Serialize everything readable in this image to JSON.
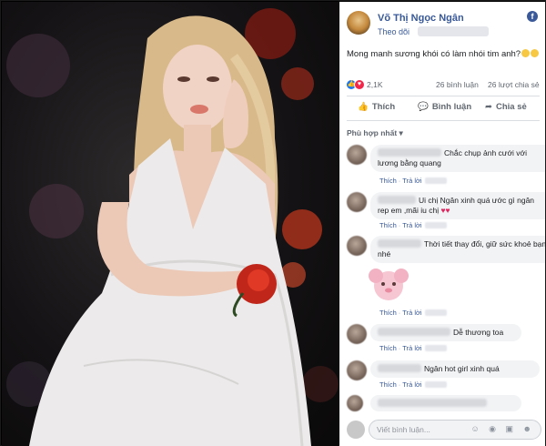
{
  "post": {
    "page_name": "Võ Thị Ngọc Ngân",
    "follow_label": "Theo dõi",
    "fb_icon": "f",
    "caption": "Mong manh sương khói có làm nhói tim anh?"
  },
  "reactions": {
    "like_icon": "👍",
    "love_icon": "♥",
    "count": "2,1K",
    "comments": "26 bình luận",
    "shares": "26 lượt chia sẻ"
  },
  "actions": {
    "like": "Thích",
    "comment": "Bình luận",
    "share": "Chia sẻ",
    "like_icon": "👍",
    "comment_icon": "💬",
    "share_icon": "➦"
  },
  "sort_label": "Phù hợp nhất ▾",
  "comments": [
    {
      "text": "Chắc chụp ảnh cưới với lương bằng quang",
      "like": "Thích",
      "reply": "Trả lời"
    },
    {
      "text": "Ui chị Ngân xinh quá ước gì ngân rep em ,mãi iu chị",
      "hearts": "♥♥",
      "like": "Thích",
      "reply": "Trả lời"
    },
    {
      "text": "Thời tiết thay đổi, giữ sức khoẻ bạn nhé",
      "like": "Thích",
      "reply": "Trả lời"
    },
    {
      "text": "Dễ thương toa",
      "like": "Thích",
      "reply": "Trả lời"
    },
    {
      "text": "Ngân hot girl xinh quá",
      "like": "Thích",
      "reply": "Trả lời"
    }
  ],
  "sticker_reply": {
    "like": "Thích",
    "reply": "Trả lời"
  },
  "composer": {
    "placeholder": "Viết bình luận...",
    "icons": "☺ ◉ ▣ ☻"
  },
  "colors": {
    "link": "#385898",
    "bubble": "#f2f3f5",
    "like": "#1877f2",
    "love": "#f0284a"
  }
}
